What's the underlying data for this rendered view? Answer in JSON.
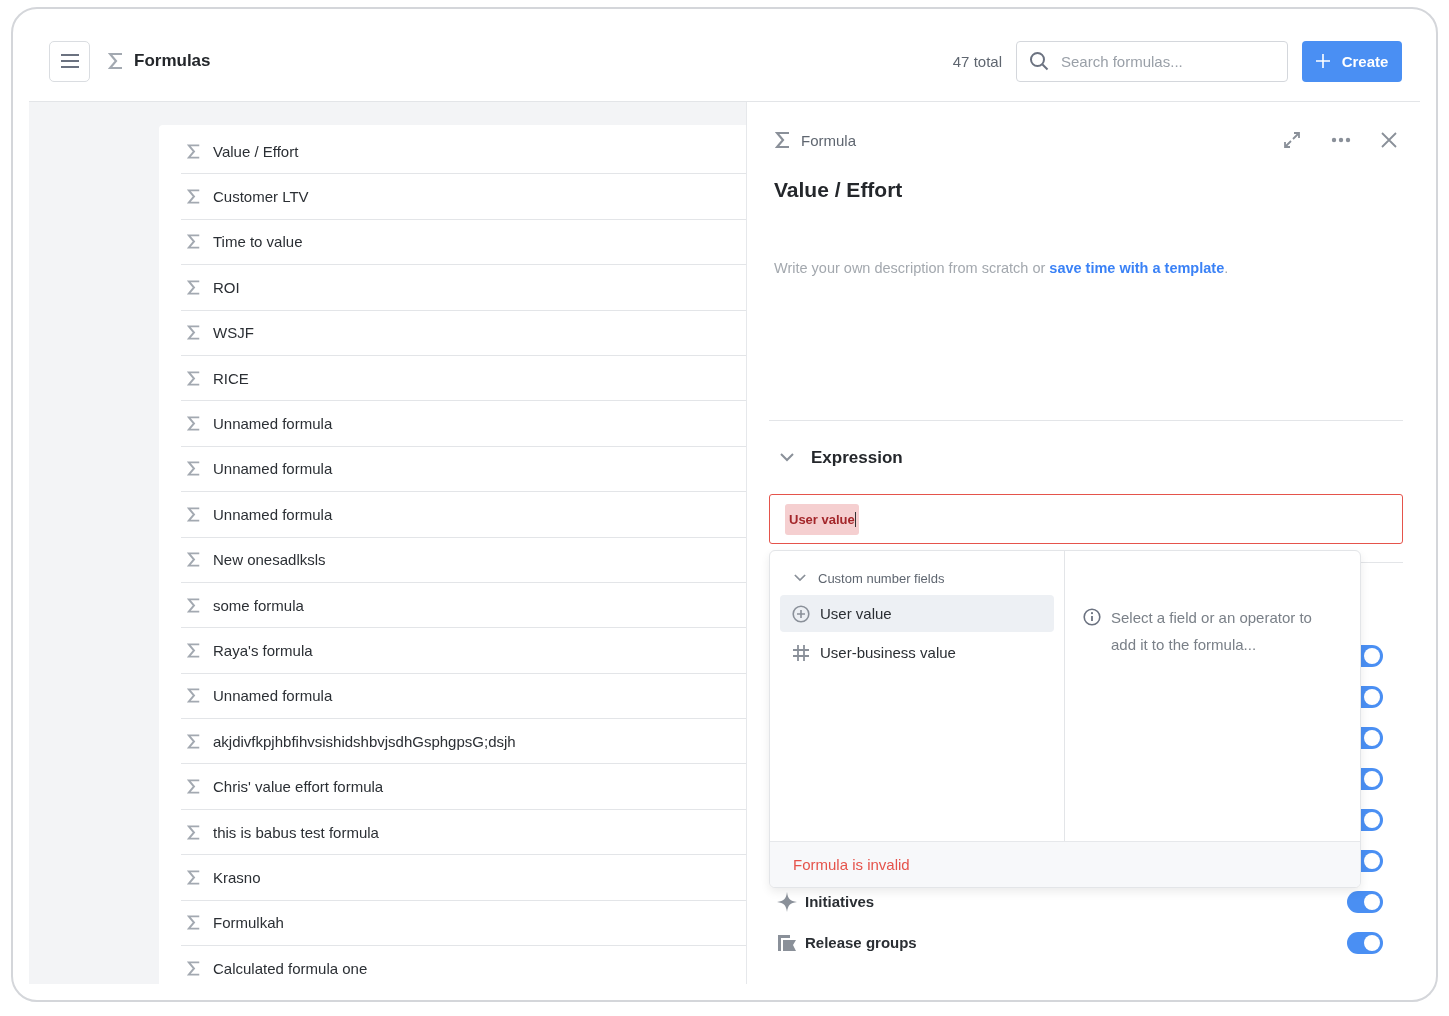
{
  "header": {
    "title": "Formulas",
    "total": "47 total",
    "search": {
      "placeholder": "Search formulas..."
    },
    "create_button": "Create"
  },
  "formulas": [
    {
      "name": "Value / Effort"
    },
    {
      "name": "Customer LTV"
    },
    {
      "name": "Time to value"
    },
    {
      "name": "ROI"
    },
    {
      "name": "WSJF"
    },
    {
      "name": "RICE"
    },
    {
      "name": "Unnamed formula"
    },
    {
      "name": "Unnamed formula"
    },
    {
      "name": "Unnamed formula"
    },
    {
      "name": "New onesadlksls"
    },
    {
      "name": "some formula"
    },
    {
      "name": "Raya's formula"
    },
    {
      "name": "Unnamed formula"
    },
    {
      "name": "akjdivfkpjhbfihvsishidshbvjsdhGsphgpsG;dsjh"
    },
    {
      "name": "Chris' value effort formula"
    },
    {
      "name": "this is babus test formula"
    },
    {
      "name": "Krasno"
    },
    {
      "name": "Formulkah"
    },
    {
      "name": "Calculated formula one"
    }
  ],
  "detail": {
    "kind_label": "Formula",
    "title": "Value / Effort",
    "description": "Write your own description from scratch or",
    "description_link": "save time with a template",
    "description_end": ".",
    "expression": {
      "heading": "Expression",
      "expanded": true,
      "token": "User value",
      "invalid": true
    },
    "picker": {
      "group": "Custom number fields",
      "group_expanded": true,
      "items": [
        {
          "label": "User value",
          "kind": "add",
          "selected": true
        },
        {
          "label": "User-business value",
          "kind": "number",
          "selected": false
        }
      ],
      "hint": "Select a field or an operator to add it to the formula...",
      "error": "Formula is invalid"
    },
    "toggles": [
      {
        "on": true
      },
      {
        "on": true
      },
      {
        "on": true
      },
      {
        "on": true
      },
      {
        "on": true
      },
      {
        "on": true
      },
      {
        "label": "Initiatives",
        "kind": "initiative",
        "on": true
      },
      {
        "label": "Release groups",
        "kind": "release",
        "on": true
      }
    ]
  }
}
